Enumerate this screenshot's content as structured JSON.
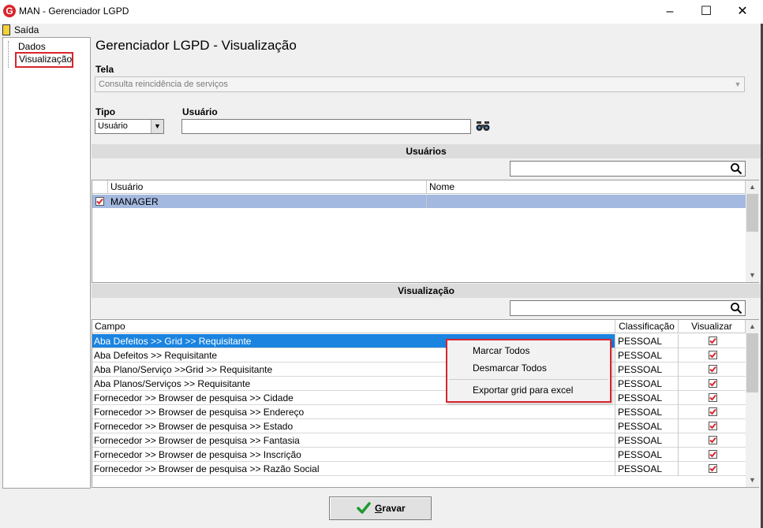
{
  "window": {
    "title": "MAN - Gerenciador LGPD",
    "app_icon_letter": "G"
  },
  "menu": {
    "exit": "Saída"
  },
  "tree": {
    "items": [
      "Dados",
      "Visualização"
    ]
  },
  "page": {
    "title": "Gerenciador LGPD - Visualização",
    "tela_label": "Tela",
    "tela_value": "Consulta reincidência de serviços",
    "tipo_label": "Tipo",
    "tipo_value": "Usuário",
    "usuario_label": "Usuário",
    "usuario_value": ""
  },
  "usuarios": {
    "header": "Usuários",
    "columns": [
      "Usuário",
      "Nome"
    ],
    "rows": [
      {
        "usuario": "MANAGER",
        "nome": "",
        "checked": true
      }
    ]
  },
  "visualizacao": {
    "header": "Visualização",
    "columns": [
      "Campo",
      "Classificação",
      "Visualizar"
    ],
    "rows": [
      {
        "campo": "Aba Defeitos >> Grid >> Requisitante",
        "classificacao": "PESSOAL",
        "visualizar": true
      },
      {
        "campo": "Aba Defeitos >> Requisitante",
        "classificacao": "PESSOAL",
        "visualizar": true
      },
      {
        "campo": "Aba Plano/Serviço >>Grid >> Requisitante",
        "classificacao": "PESSOAL",
        "visualizar": true
      },
      {
        "campo": "Aba Planos/Serviços >> Requisitante",
        "classificacao": "PESSOAL",
        "visualizar": true
      },
      {
        "campo": "Fornecedor >> Browser de pesquisa >> Cidade",
        "classificacao": "PESSOAL",
        "visualizar": true
      },
      {
        "campo": "Fornecedor >> Browser de pesquisa >> Endereço",
        "classificacao": "PESSOAL",
        "visualizar": true
      },
      {
        "campo": "Fornecedor >> Browser de pesquisa >> Estado",
        "classificacao": "PESSOAL",
        "visualizar": true
      },
      {
        "campo": "Fornecedor >> Browser de pesquisa >> Fantasia",
        "classificacao": "PESSOAL",
        "visualizar": true
      },
      {
        "campo": "Fornecedor >> Browser de pesquisa >> Inscrição",
        "classificacao": "PESSOAL",
        "visualizar": true
      },
      {
        "campo": "Fornecedor >> Browser de pesquisa >> Razão Social",
        "classificacao": "PESSOAL",
        "visualizar": true
      }
    ]
  },
  "context_menu": {
    "items": [
      "Marcar Todos",
      "Desmarcar Todos",
      "Exportar grid para excel"
    ]
  },
  "buttons": {
    "save": "Gravar"
  },
  "colors": {
    "selection": "#1a84e0",
    "highlight_border": "#d9252c",
    "user_row": "#a3b9e0"
  }
}
